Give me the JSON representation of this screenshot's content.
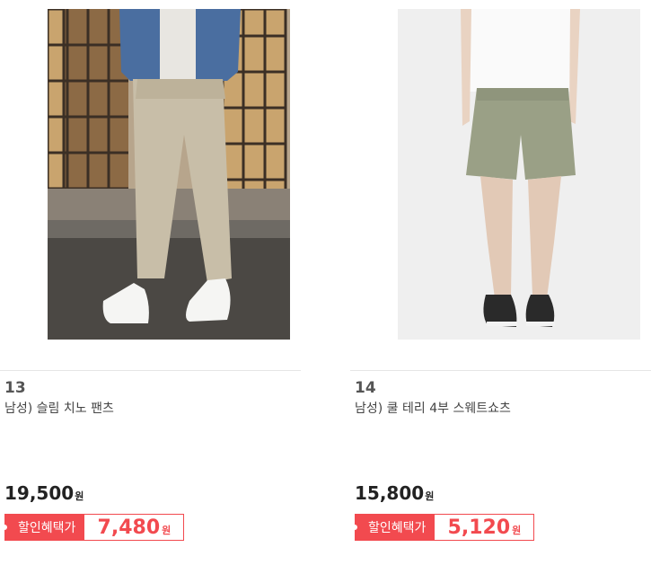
{
  "products": [
    {
      "rank": "13",
      "name": "남성) 슬림 치노 팬츠",
      "price": "19,500",
      "price_unit": "원",
      "benefit_label": "할인혜택가",
      "benefit_price": "7,480",
      "benefit_unit": "원"
    },
    {
      "rank": "14",
      "name": "남성) 쿨 테리 4부 스웨트쇼츠",
      "price": "15,800",
      "price_unit": "원",
      "benefit_label": "할인혜택가",
      "benefit_price": "5,120",
      "benefit_unit": "원"
    }
  ],
  "colors": {
    "accent": "#f24a4f"
  }
}
